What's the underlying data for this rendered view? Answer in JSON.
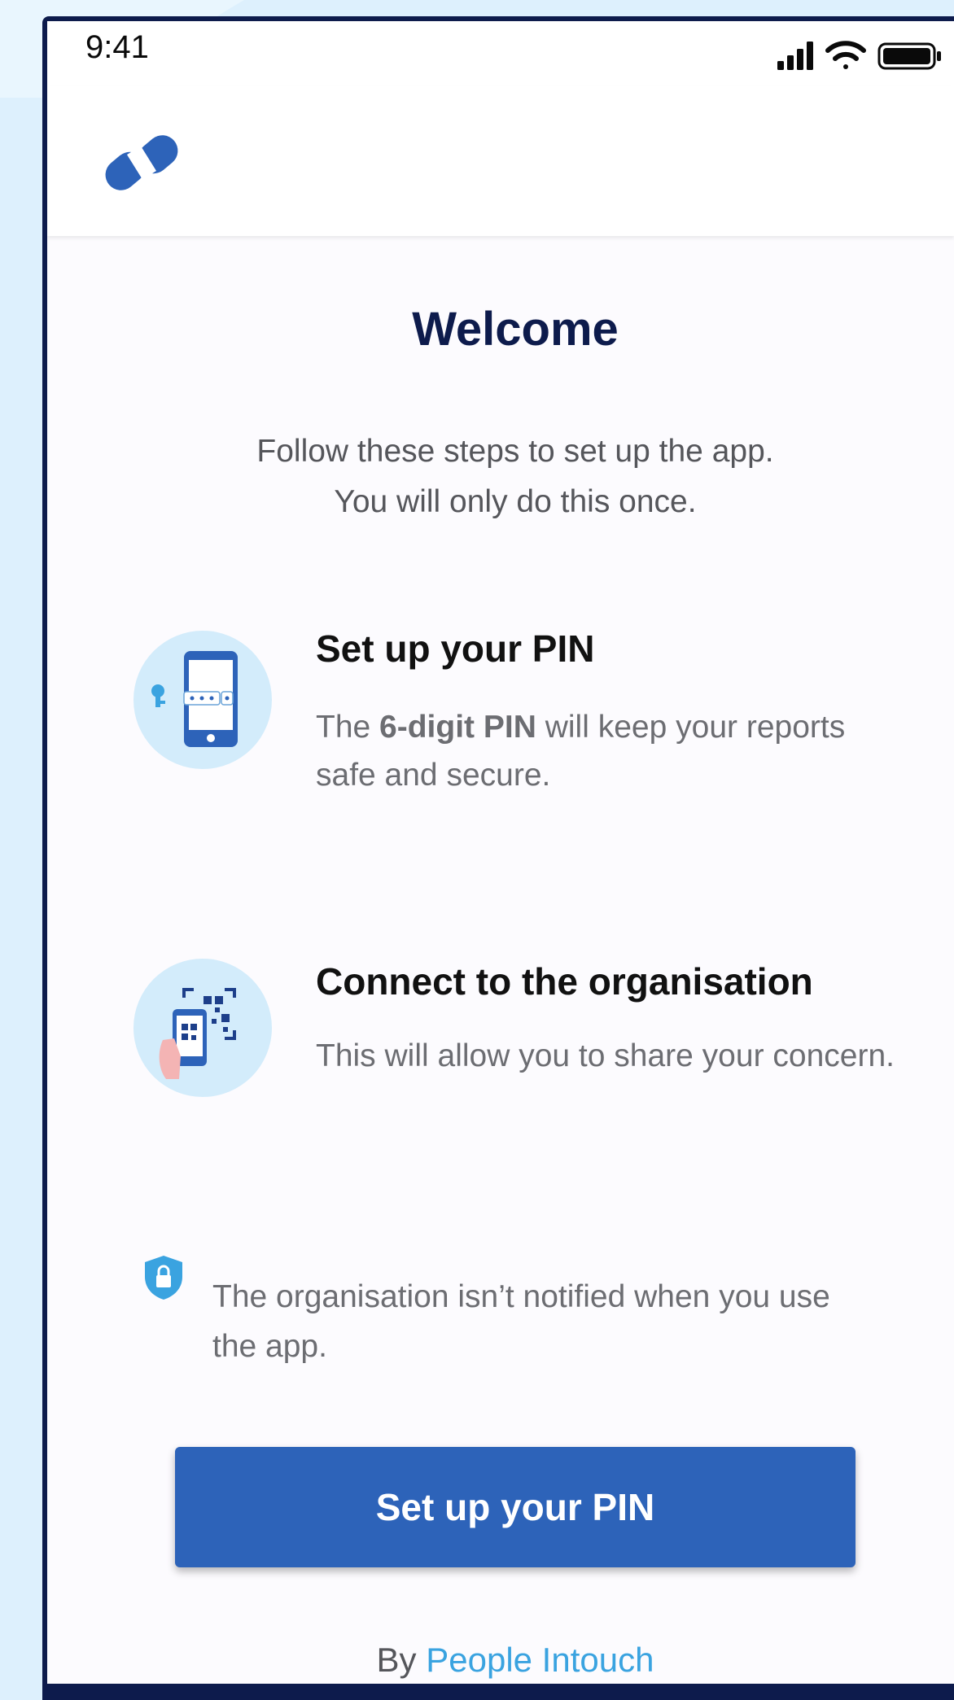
{
  "status_bar": {
    "time": "9:41",
    "icons": [
      "signal-icon",
      "wifi-icon",
      "battery-icon"
    ]
  },
  "header": {
    "logo": "app-logo"
  },
  "title": "Welcome",
  "intro": {
    "line1": "Follow these steps to set up the app.",
    "line2": "You will only do this once."
  },
  "steps": [
    {
      "icon": "phone-pin-icon",
      "title": "Set up your PIN",
      "desc_before": "The ",
      "desc_bold": "6-digit PIN",
      "desc_after": " will keep your reports safe and secure."
    },
    {
      "icon": "qr-scan-icon",
      "title": "Connect to the organisation",
      "desc": "This will allow you to share your concern."
    }
  ],
  "privacy": {
    "icon": "shield-lock-icon",
    "text": "The organisation isn’t notified when you use the app."
  },
  "cta": {
    "label": "Set up your PIN"
  },
  "footer": {
    "prefix": "By",
    "brand": "People Intouch"
  },
  "colors": {
    "primary_button": "#2d63b9",
    "title": "#0d1b4c",
    "brand_link": "#3aa3e0",
    "icon_circle": "#d3ecfb",
    "page_background": "#ddf0fd"
  }
}
